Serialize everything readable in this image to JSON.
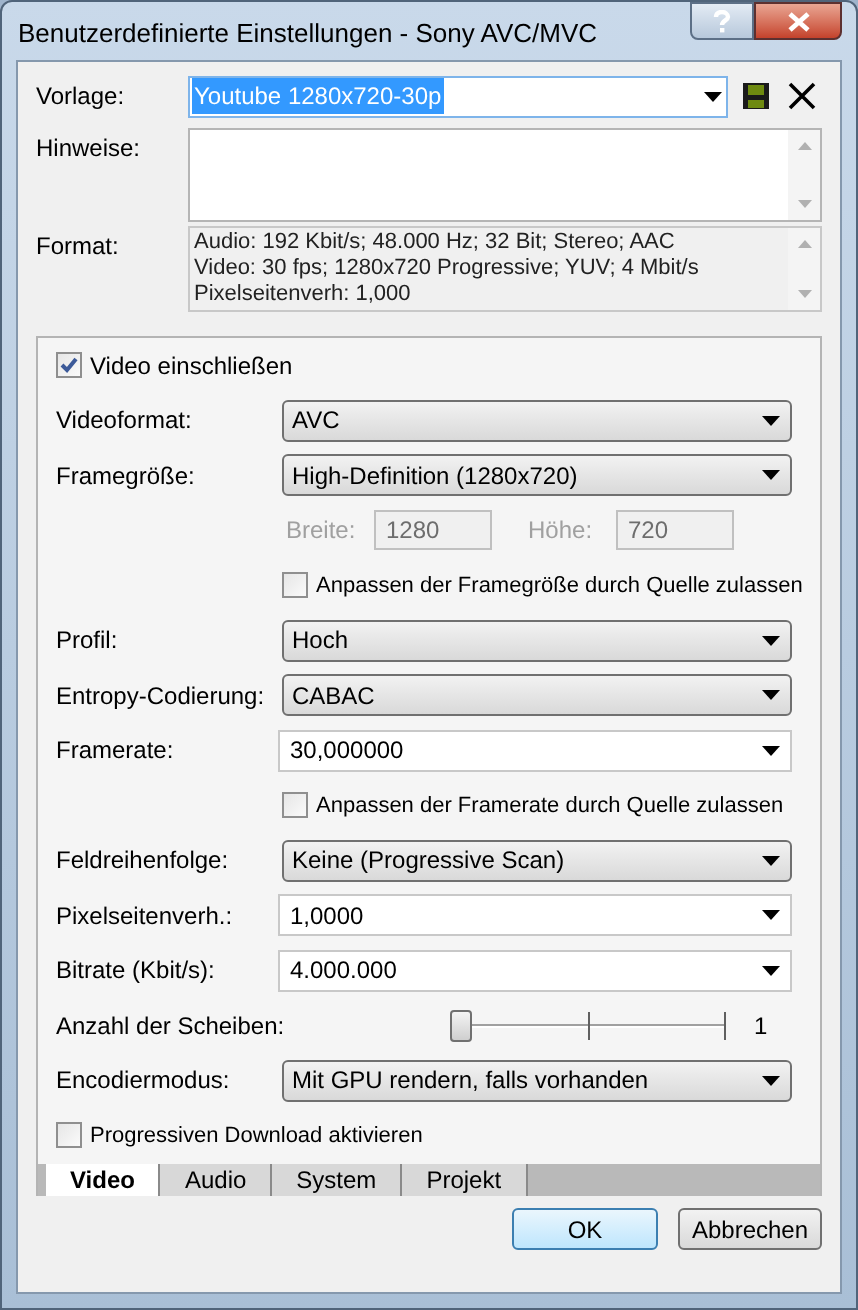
{
  "window": {
    "title": "Benutzerdefinierte Einstellungen - Sony AVC/MVC"
  },
  "template": {
    "label": "Vorlage:",
    "value": "Youtube 1280x720-30p",
    "selected": true
  },
  "notes": {
    "label": "Hinweise:"
  },
  "format": {
    "label": "Format:",
    "lines": [
      "Audio: 192 Kbit/s; 48.000 Hz; 32 Bit; Stereo; AAC",
      "Video: 30 fps; 1280x720 Progressive; YUV; 4 Mbit/s",
      "Pixelseitenverh: 1,000"
    ]
  },
  "include_video": {
    "label": "Video einschließen",
    "checked": true
  },
  "rows": [
    {
      "kind": "dropdown",
      "label": "Videoformat:",
      "value": "AVC"
    },
    {
      "kind": "dropdown",
      "label": "Framegröße:",
      "value": "High-Definition (1280x720)"
    },
    {
      "kind": "size",
      "fields": [
        {
          "label": "Breite:",
          "value": "1280",
          "disabled": true
        },
        {
          "label": "Höhe:",
          "value": "720",
          "disabled": true
        }
      ]
    },
    {
      "kind": "checkbox",
      "label": "Anpassen der Framegröße durch Quelle zulassen",
      "checked": false
    },
    {
      "kind": "dropdown",
      "label": "Profil:",
      "value": "Hoch"
    },
    {
      "kind": "dropdown",
      "label": "Entropy-Codierung:",
      "value": "CABAC"
    },
    {
      "kind": "combo",
      "label": "Framerate:",
      "value": "30,000000"
    },
    {
      "kind": "checkbox",
      "label": "Anpassen der Framerate durch Quelle zulassen",
      "checked": false
    },
    {
      "kind": "dropdown",
      "label": "Feldreihenfolge:",
      "value": "Keine (Progressive Scan)"
    },
    {
      "kind": "combo",
      "label": "Pixelseitenverh.:",
      "value": "1,0000"
    },
    {
      "kind": "combo",
      "label": "Bitrate (Kbit/s):",
      "value": "4.000.000"
    },
    {
      "kind": "slider",
      "label": "Anzahl der Scheiben:",
      "level": 0,
      "reading": "1"
    },
    {
      "kind": "dropdown",
      "label": "Encodiermodus:",
      "value": "Mit GPU rendern, falls vorhanden"
    },
    {
      "kind": "option",
      "label": "Progressiven Download aktivieren",
      "checked": false
    }
  ],
  "tabs": [
    {
      "label": "Video",
      "selected": true
    },
    {
      "label": "Audio",
      "selected": false
    },
    {
      "label": "System",
      "selected": false
    },
    {
      "label": "Projekt",
      "selected": false
    }
  ],
  "buttons": [
    {
      "label": "OK",
      "default": true
    },
    {
      "label": "Abbrechen",
      "default": false
    }
  ]
}
